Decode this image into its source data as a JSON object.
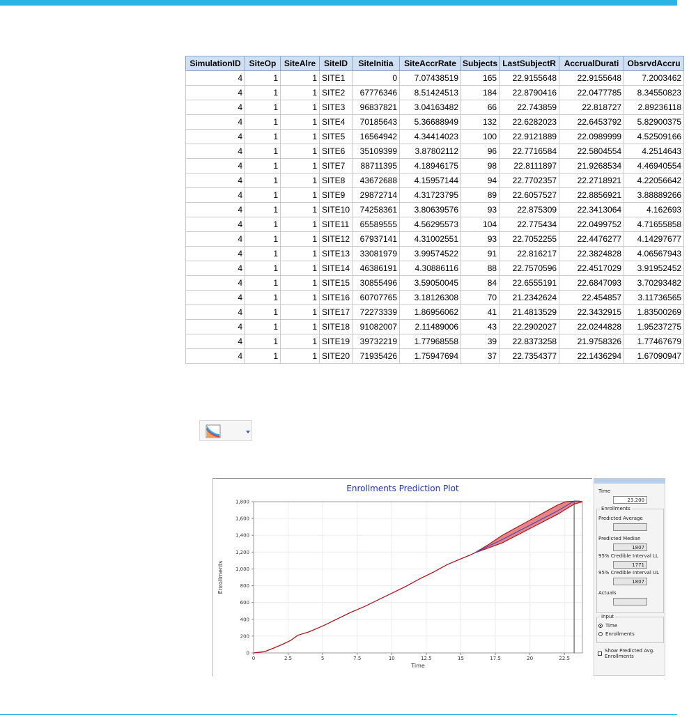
{
  "table": {
    "columns": [
      "SimulationID",
      "SiteOp",
      "SiteAlre",
      "SiteID",
      "SiteInitia",
      "SiteAccrRate",
      "Subjects",
      "LastSubjectR",
      "AccrualDurati",
      "ObsrvdAccru"
    ],
    "rows": [
      [
        "4",
        "1",
        "1",
        "SITE1",
        "0",
        "7.07438519",
        "165",
        "22.9155648",
        "22.9155648",
        "7.2003462"
      ],
      [
        "4",
        "1",
        "1",
        "SITE2",
        "67776346",
        "8.51424513",
        "184",
        "22.8790416",
        "22.0477785",
        "8.34550823"
      ],
      [
        "4",
        "1",
        "1",
        "SITE3",
        "96837821",
        "3.04163482",
        "66",
        "22.743859",
        "22.818727",
        "2.89236118"
      ],
      [
        "4",
        "1",
        "1",
        "SITE4",
        "70185643",
        "5.36688949",
        "132",
        "22.6282023",
        "22.6453792",
        "5.82900375"
      ],
      [
        "4",
        "1",
        "1",
        "SITE5",
        "16564942",
        "4.34414023",
        "100",
        "22.9121889",
        "22.0989999",
        "4.52509166"
      ],
      [
        "4",
        "1",
        "1",
        "SITE6",
        "35109399",
        "3.87802112",
        "96",
        "22.7716584",
        "22.5804554",
        "4.2514643"
      ],
      [
        "4",
        "1",
        "1",
        "SITE7",
        "88711395",
        "4.18946175",
        "98",
        "22.8111897",
        "21.9268534",
        "4.46940554"
      ],
      [
        "4",
        "1",
        "1",
        "SITE8",
        "43672688",
        "4.15957144",
        "94",
        "22.7702357",
        "22.2718921",
        "4.22056642"
      ],
      [
        "4",
        "1",
        "1",
        "SITE9",
        "29872714",
        "4.31723795",
        "89",
        "22.6057527",
        "22.8856921",
        "3.88889266"
      ],
      [
        "4",
        "1",
        "1",
        "SITE10",
        "74258361",
        "3.80639576",
        "93",
        "22.875309",
        "22.3413064",
        "4.162693"
      ],
      [
        "4",
        "1",
        "1",
        "SITE11",
        "65589555",
        "4.56295573",
        "104",
        "22.775434",
        "22.0499752",
        "4.71655858"
      ],
      [
        "4",
        "1",
        "1",
        "SITE12",
        "67937141",
        "4.31002551",
        "93",
        "22.7052255",
        "22.4476277",
        "4.14297677"
      ],
      [
        "4",
        "1",
        "1",
        "SITE13",
        "33081979",
        "3.99574522",
        "91",
        "22.816217",
        "22.3824828",
        "4.06567943"
      ],
      [
        "4",
        "1",
        "1",
        "SITE14",
        "46386191",
        "4.30886116",
        "88",
        "22.7570596",
        "22.4517029",
        "3.91952452"
      ],
      [
        "4",
        "1",
        "1",
        "SITE15",
        "30855496",
        "3.59050045",
        "84",
        "22.6555191",
        "22.6847093",
        "3.70293482"
      ],
      [
        "4",
        "1",
        "1",
        "SITE16",
        "60707765",
        "3.18126308",
        "70",
        "21.2342624",
        "22.454857",
        "3.11736565"
      ],
      [
        "4",
        "1",
        "1",
        "SITE17",
        "72273339",
        "1.86956062",
        "41",
        "21.4813529",
        "22.3432915",
        "1.83500269"
      ],
      [
        "4",
        "1",
        "1",
        "SITE18",
        "91082007",
        "2.11489006",
        "43",
        "22.2902027",
        "22.0244828",
        "1.95237275"
      ],
      [
        "4",
        "1",
        "1",
        "SITE19",
        "39732219",
        "1.77968558",
        "39",
        "22.8373258",
        "21.9758326",
        "1.77467679"
      ],
      [
        "4",
        "1",
        "1",
        "SITE20",
        "71935426",
        "1.75947694",
        "37",
        "22.7354377",
        "22.1436294",
        "1.67090947"
      ]
    ]
  },
  "chart_button": {
    "icon": "chart-type-icon",
    "dropdown_icon": "chevron-down-icon"
  },
  "chart_data": {
    "type": "line",
    "title": "Enrollments Prediction Plot",
    "xlabel": "Time",
    "ylabel": "Enrollments",
    "xlim": [
      0,
      23.8
    ],
    "ylim": [
      0,
      1800
    ],
    "x_ticks": [
      "0",
      "2.5",
      "5",
      "7.5",
      "10",
      "12.5",
      "15",
      "17.5",
      "20",
      "22.5"
    ],
    "y_ticks": [
      "0",
      "200",
      "400",
      "600",
      "800",
      "1,000",
      "1,200",
      "1,400",
      "1,600",
      "1,800"
    ],
    "actuals": [
      [
        0,
        0
      ],
      [
        0.8,
        15
      ],
      [
        1.5,
        60
      ],
      [
        2.2,
        110
      ],
      [
        2.7,
        150
      ],
      [
        3.2,
        210
      ],
      [
        4,
        250
      ],
      [
        5,
        320
      ],
      [
        6,
        400
      ],
      [
        7,
        480
      ],
      [
        8,
        550
      ],
      [
        9,
        630
      ],
      [
        10,
        710
      ],
      [
        11,
        790
      ],
      [
        12,
        880
      ],
      [
        13,
        960
      ],
      [
        14,
        1050
      ],
      [
        15,
        1120
      ],
      [
        15.6,
        1160
      ],
      [
        16,
        1190
      ]
    ],
    "prediction_median": [
      [
        16,
        1190
      ],
      [
        18,
        1350
      ],
      [
        20,
        1520
      ],
      [
        22,
        1690
      ],
      [
        23.2,
        1807
      ],
      [
        23.5,
        1807
      ]
    ],
    "ci_lower": [
      [
        16,
        1190
      ],
      [
        18,
        1310
      ],
      [
        20,
        1480
      ],
      [
        22,
        1650
      ],
      [
        23.2,
        1771
      ],
      [
        23.8,
        1800
      ]
    ],
    "ci_upper": [
      [
        16,
        1190
      ],
      [
        17,
        1290
      ],
      [
        18,
        1400
      ],
      [
        20,
        1580
      ],
      [
        22,
        1760
      ],
      [
        22.6,
        1800
      ],
      [
        23.5,
        1807
      ]
    ],
    "vertical_marker": 23.2,
    "colors": {
      "actual": "#b0161c",
      "median": "#4a4ab8",
      "band": "#e07070",
      "title": "#2233bb"
    }
  },
  "side_panel": {
    "time_label": "Time",
    "time_value": "23.200",
    "enrollments_group": "Enrollments",
    "predicted_average_label": "Predicted Average",
    "predicted_average_value": "",
    "predicted_median_label": "Predicted Median",
    "predicted_median_value": "1807",
    "ci_ll_label": "95% Credible Interval LL",
    "ci_ll_value": "1771",
    "ci_ul_label": "95% Credible Interval UL",
    "ci_ul_value": "1807",
    "actuals_label": "Actuals",
    "actuals_value": "",
    "input_group": "Input",
    "input_options": [
      "Time",
      "Enrollments"
    ],
    "input_selected": "Time",
    "show_avg_label": "Show Predicted Avg. Enrollments"
  }
}
